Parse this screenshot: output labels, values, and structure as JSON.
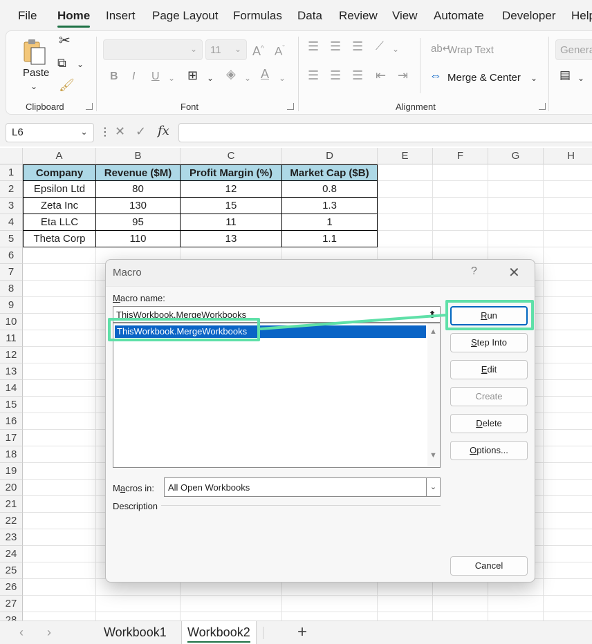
{
  "ribbon_tabs": [
    "File",
    "Home",
    "Insert",
    "Page Layout",
    "Formulas",
    "Data",
    "Review",
    "View",
    "Automate",
    "Developer",
    "Help"
  ],
  "active_tab": "Home",
  "ribbon": {
    "clipboard": {
      "paste_label": "Paste",
      "group_label": "Clipboard"
    },
    "font": {
      "font_name": "",
      "font_size": "11",
      "group_label": "Font"
    },
    "alignment": {
      "wrap_text": "Wrap Text",
      "merge_center": "Merge & Center",
      "group_label": "Alignment"
    },
    "number": {
      "format": "General"
    }
  },
  "formula_bar": {
    "name_box": "L6",
    "formula": "",
    "fx_symbol": "fx"
  },
  "sheet": {
    "columns": [
      "A",
      "B",
      "C",
      "D",
      "E",
      "F",
      "G",
      "H"
    ],
    "rows": [
      "1",
      "2",
      "3",
      "4",
      "5",
      "6",
      "7",
      "8",
      "9",
      "10",
      "11",
      "12",
      "13",
      "14",
      "15",
      "16",
      "17",
      "18",
      "19",
      "20",
      "21",
      "22",
      "23",
      "24",
      "25",
      "26",
      "27",
      "28"
    ],
    "table": {
      "headers": [
        "Company",
        "Revenue ($M)",
        "Profit Margin (%)",
        "Market Cap ($B)"
      ],
      "rows": [
        [
          "Epsilon Ltd",
          "80",
          "12",
          "0.8"
        ],
        [
          "Zeta Inc",
          "130",
          "15",
          "1.3"
        ],
        [
          "Eta LLC",
          "95",
          "11",
          "1"
        ],
        [
          "Theta Corp",
          "110",
          "13",
          "1.1"
        ]
      ]
    }
  },
  "sheet_tabs": {
    "tabs": [
      "Workbook1",
      "Workbook2"
    ],
    "active": "Workbook2",
    "add_symbol": "+"
  },
  "dialog": {
    "title": "Macro",
    "help": "?",
    "close": "✕",
    "macro_name_label_prefix": "M",
    "macro_name_label_rest": "acro name:",
    "macro_name_value": "ThisWorkbook.MergeWorkbooks",
    "macro_list": [
      "ThisWorkbook.MergeWorkbooks"
    ],
    "buttons": {
      "run": {
        "pre": "",
        "accel": "R",
        "post": "un"
      },
      "step_into": {
        "pre": "",
        "accel": "S",
        "post": "tep Into"
      },
      "edit": {
        "pre": "",
        "accel": "E",
        "post": "dit"
      },
      "create": {
        "pre": "Create",
        "accel": "",
        "post": ""
      },
      "delete": {
        "pre": "",
        "accel": "D",
        "post": "elete"
      },
      "options": {
        "pre": "",
        "accel": "O",
        "post": "ptions..."
      },
      "cancel": {
        "pre": "Cancel",
        "accel": "",
        "post": ""
      }
    },
    "macros_in_label_prefix": "M",
    "macros_in_label_accel": "a",
    "macros_in_label_rest": "cros in:",
    "macros_in_value": "All Open Workbooks",
    "description_label": "Description"
  },
  "colors": {
    "accent_green": "#1e7145",
    "table_header_fill": "#add8e6",
    "highlight": "#5fe0a8",
    "selection_blue": "#0a64c6"
  }
}
